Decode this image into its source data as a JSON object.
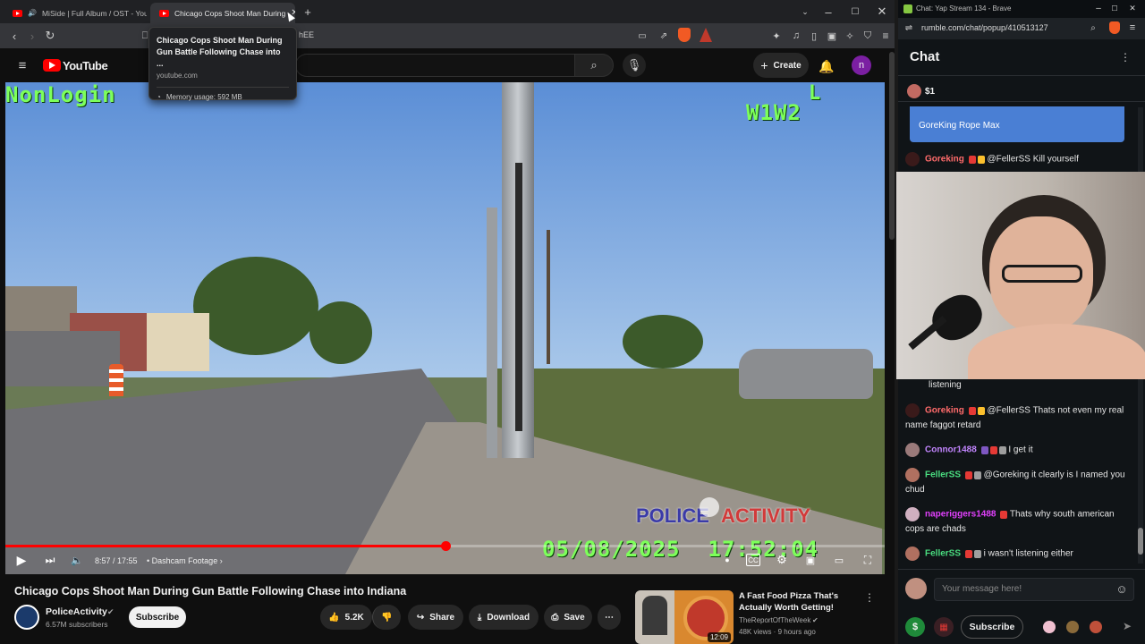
{
  "left_window": {
    "tabs": [
      {
        "label": "MiSide | Full Album / OST - YouTu"
      },
      {
        "label": "Chicago Cops Shoot Man During"
      }
    ],
    "address_fragment": "hEE",
    "tooltip": {
      "title": "Chicago Cops Shoot Man During Gun Battle Following Chase into ...",
      "domain": "youtube.com",
      "memory": "Memory usage: 592 MB"
    }
  },
  "youtube": {
    "logo_text": "YouTube",
    "create_label": "Create",
    "avatar_letter": "n"
  },
  "video": {
    "overlay_top_left": "NonLogin",
    "overlay_top_right_1": "L",
    "overlay_top_right_2": "W1W2",
    "watermark_left": "POLICE",
    "watermark_right": "ACTIVITY",
    "timestamp": "05/08/2025  17:52:04",
    "time_display": "8:57 / 17:55",
    "chapter": "Dashcam Footage",
    "progress": 0.5
  },
  "meta": {
    "title": "Chicago Cops Shoot Man During Gun Battle Following Chase into Indiana",
    "channel": "PoliceActivity",
    "subscribers": "6.57M subscribers",
    "subscribe_label": "Subscribe",
    "likes": "5.2K",
    "share_label": "Share",
    "download_label": "Download",
    "save_label": "Save"
  },
  "recommendation": {
    "title": "A Fast Food Pizza That's Actually Worth Getting!",
    "channel": "TheReportOfTheWeek",
    "stats": "48K views · 9 hours ago",
    "duration": "12:09"
  },
  "right_window": {
    "tab_title": "Chat: Yap Stream 134 - Brave",
    "url": "rumble.com/chat/popup/410513127",
    "chat_header": "Chat",
    "tip_amount": "$1",
    "pinned_text": "GoreKing Rope Max",
    "input_placeholder": "Your message here!",
    "subscribe_label": "Subscribe",
    "messages": [
      {
        "user": "Goreking",
        "text": "@FellerSS Kill yourself",
        "color": "#ff6b6b"
      },
      {
        "user": "",
        "text": "listening",
        "color": "#e6e6e6"
      },
      {
        "user": "Goreking",
        "text": "@FellerSS Thats not even my real name faggot retard",
        "color": "#ff6b6b"
      },
      {
        "user": "Connor1488",
        "text": "I get it",
        "color": "#c084fc"
      },
      {
        "user": "FellerSS",
        "text": "@Goreking it clearly is I named you chud",
        "color": "#4ade80"
      },
      {
        "user": "naperiggers1488",
        "text": "Thats why south american cops are chads",
        "color": "#e040fb"
      },
      {
        "user": "FellerSS",
        "text": "i wasn't listening either",
        "color": "#4ade80"
      }
    ]
  }
}
